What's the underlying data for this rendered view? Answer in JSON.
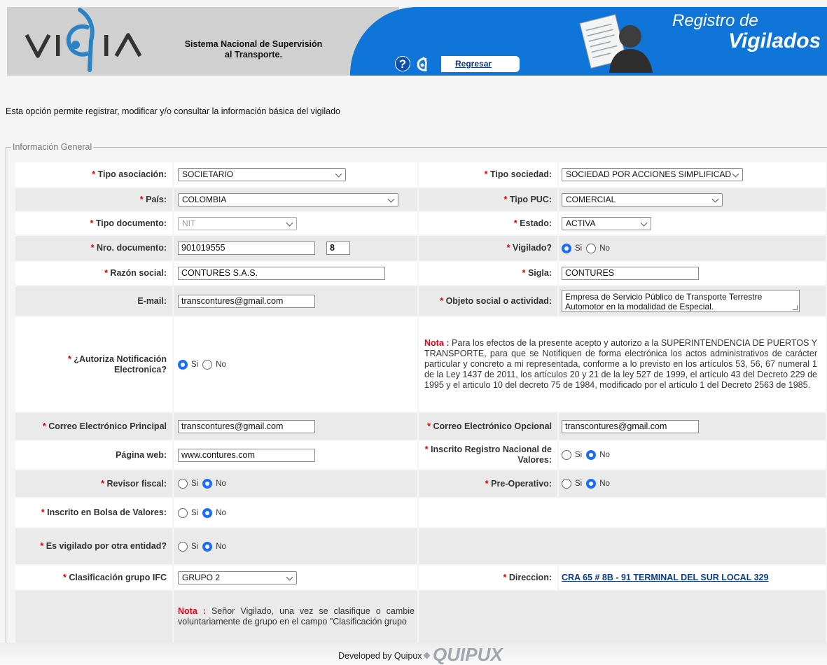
{
  "header": {
    "logo_text": "VIGIA",
    "system_name": "Sistema Nacional de Supervisión al Transporte.",
    "help_icon": "?",
    "back_label": "Regresar",
    "title_line1": "Registro de",
    "title_line2": "Vigilados",
    "colors": {
      "grey": "#d0d0d0",
      "blue": "#0f75d8"
    }
  },
  "intro": "Esta opción permite registrar, modificar y/o consultar la información básica del vigilado",
  "section_legend": "Información General",
  "required_mark": "*",
  "form": {
    "tipo_asociacion": {
      "label": "Tipo asociación:",
      "value": "SOCIETARIO"
    },
    "tipo_sociedad": {
      "label": "Tipo sociedad:",
      "value": "SOCIEDAD POR ACCIONES SIMPLIFICAD"
    },
    "pais": {
      "label": "País:",
      "value": "COLOMBIA"
    },
    "tipo_puc": {
      "label": "Tipo PUC:",
      "value": "COMERCIAL"
    },
    "tipo_documento": {
      "label": "Tipo documento:",
      "value": "NIT"
    },
    "estado": {
      "label": "Estado:",
      "value": "ACTIVA"
    },
    "nro_documento": {
      "label": "Nro. documento:",
      "value": "901019555",
      "dv": "8"
    },
    "vigilado": {
      "label": "Vigilado?",
      "selected": "Si"
    },
    "razon_social": {
      "label": "Razón social:",
      "value": "CONTURES S.A.S."
    },
    "sigla": {
      "label": "Sigla:",
      "value": "CONTURES"
    },
    "email": {
      "label": "E-mail:",
      "value": "transcontures@gmail.com"
    },
    "objeto_social": {
      "label": "Objeto social o actividad:",
      "line1": "Empresa de Servicio Público de Transporte Terrestre",
      "line2": "Automotor en la modalidad de Especial."
    },
    "autoriza_notificacion": {
      "label": "¿Autoriza Notificación Electronica?",
      "selected": "Si"
    },
    "nota_notificacion": {
      "prefix": "Nota :",
      "text": "Para los efectos de la presente acepto y autorizo a la SUPERINTENDENCIA DE PUERTOS Y TRANSPORTE, para que se Notifiquen de forma electrónica los actos administrativos de carácter particular y concreto a mi representada, conforme a lo previsto en los artículos 53, 56, 67 numeral 1 de la Ley 1437 de 2011, los artículos 20 y 21 de la ley 527 de 1999, el artículo 43 del Decreto 229 de 1995 y el articulo 10 del decreto 75 de 1984, modificado por el artículo 1 del Decreto 2563 de 1985."
    },
    "correo_principal": {
      "label": "Correo Electrónico Principal",
      "value": "transcontures@gmail.com"
    },
    "correo_opcional": {
      "label": "Correo Electrónico Opcional",
      "value": "transcontures@gmail.com"
    },
    "pagina_web": {
      "label": "Página web:",
      "value": "www.contures.com"
    },
    "inscrito_rnv": {
      "label": "Inscrito Registro Nacional de Valores:",
      "selected": "No"
    },
    "revisor_fiscal": {
      "label": "Revisor fiscal:",
      "selected": "No"
    },
    "pre_operativo": {
      "label": "Pre-Operativo:",
      "selected": "No"
    },
    "inscrito_bolsa": {
      "label": "Inscrito en Bolsa de Valores:",
      "selected": "No"
    },
    "vigilado_otra": {
      "label": "Es vigilado por otra entidad?",
      "selected": "No"
    },
    "clasificacion_ifc": {
      "label": "Clasificación grupo IFC",
      "value": "GRUPO 2"
    },
    "direccion": {
      "label": "Direccion:",
      "value": "CRA 65 # 8B - 91 TERMINAL DEL SUR LOCAL 329"
    },
    "nota_grupo": {
      "prefix": "Nota :",
      "text": "Señor Vigilado, una vez se clasifique o cambie voluntariamente de grupo en el campo \"Clasificación grupo"
    }
  },
  "radio_labels": {
    "si": "Si",
    "no": "No"
  },
  "footer": {
    "developed_by": "Developed by Quipux",
    "brand": "QUIPUX"
  }
}
